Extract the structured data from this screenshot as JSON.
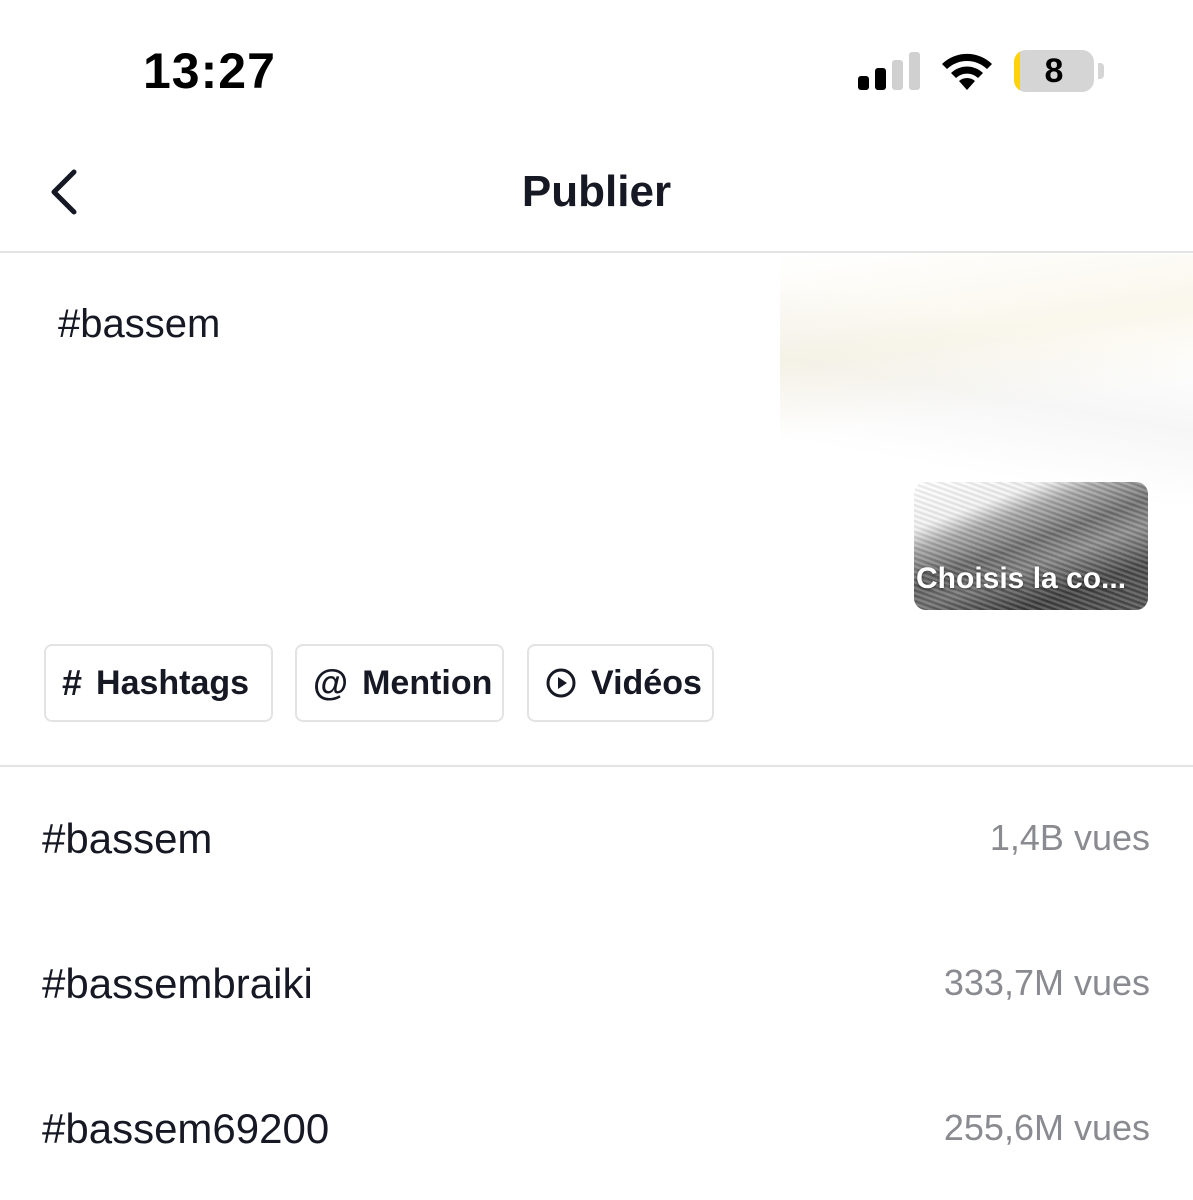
{
  "status_bar": {
    "time": "13:27",
    "battery_level": "8",
    "battery_fraction": 0.08,
    "battery_fill_color": "#ffd20a",
    "icons": [
      "cellular-signal-icon",
      "wifi-icon",
      "battery-icon"
    ]
  },
  "nav": {
    "title": "Publier",
    "back_icon": "chevron-left-icon"
  },
  "caption": {
    "text": "#bassem"
  },
  "cover": {
    "label": "Choisis la co..."
  },
  "chips": [
    {
      "icon": "hash-icon",
      "icon_glyph": "#",
      "label": "Hashtags"
    },
    {
      "icon": "at-icon",
      "icon_glyph": "@",
      "label": "Mention"
    },
    {
      "icon": "play-circle-icon",
      "icon_glyph": "",
      "label": "Vidéos"
    }
  ],
  "suggestions": [
    {
      "tag": "#bassem",
      "views": "1,4B vues"
    },
    {
      "tag": "#bassembraiki",
      "views": "333,7M vues"
    },
    {
      "tag": "#bassem69200",
      "views": "255,6M vues"
    }
  ]
}
